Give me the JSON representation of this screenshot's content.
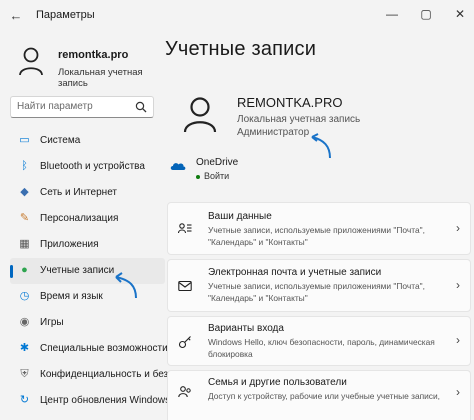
{
  "window": {
    "title": "Параметры",
    "back_icon": "back-arrow-icon",
    "controls": [
      "minimize-icon",
      "maximize-icon",
      "close-icon"
    ]
  },
  "sidebar": {
    "user_name": "remontka.pro",
    "user_subtitle": "Локальная учетная запись",
    "search_placeholder": "Найти параметр",
    "items": [
      {
        "label": "Система",
        "icon": "monitor-icon",
        "color": "#0078d4"
      },
      {
        "label": "Bluetooth и устройства",
        "icon": "bluetooth-icon",
        "color": "#0078d4"
      },
      {
        "label": "Сеть и Интернет",
        "icon": "wifi-icon",
        "color": "#3a6fb0"
      },
      {
        "label": "Персонализация",
        "icon": "brush-icon",
        "color": "#c77a2e"
      },
      {
        "label": "Приложения",
        "icon": "apps-icon",
        "color": "#555555"
      },
      {
        "label": "Учетные записи",
        "icon": "user-icon",
        "color": "#2ea44f",
        "active": true
      },
      {
        "label": "Время и язык",
        "icon": "globe-clock-icon",
        "color": "#0078d4"
      },
      {
        "label": "Игры",
        "icon": "gamepad-icon",
        "color": "#666666"
      },
      {
        "label": "Специальные возможности",
        "icon": "accessibility-icon",
        "color": "#0078d4"
      },
      {
        "label": "Конфиденциальность и безо",
        "icon": "shield-icon",
        "color": "#666666"
      },
      {
        "label": "Центр обновления Windows",
        "icon": "update-icon",
        "color": "#0078d4"
      }
    ]
  },
  "main": {
    "title": "Учетные записи",
    "account_name": "REMONTKA.PRO",
    "account_type": "Локальная учетная запись",
    "account_role": "Администратор",
    "onedrive_title": "OneDrive",
    "onedrive_status": "Войти",
    "cards": [
      {
        "title": "Ваши данные",
        "desc1": "Учетные записи, используемые приложениями \"Почта\",",
        "desc2": "\"Календарь\" и \"Контакты\"",
        "icon": "person-card-icon"
      },
      {
        "title": "Электронная почта и учетные записи",
        "desc1": "Учетные записи, используемые приложениями \"Почта\",",
        "desc2": "\"Календарь\" и \"Контакты\"",
        "icon": "mail-icon"
      },
      {
        "title": "Варианты входа",
        "desc1": "Windows Hello, ключ безопасности, пароль, динамическая",
        "desc2": "блокировка",
        "icon": "key-icon"
      },
      {
        "title": "Семья и другие пользователи",
        "desc1": "Доступ к устройству, рабочие или учебные учетные записи,",
        "desc2": "",
        "icon": "family-icon"
      }
    ]
  },
  "colors": {
    "accent": "#0067c0",
    "annotation_arrow": "#1a73c8"
  }
}
